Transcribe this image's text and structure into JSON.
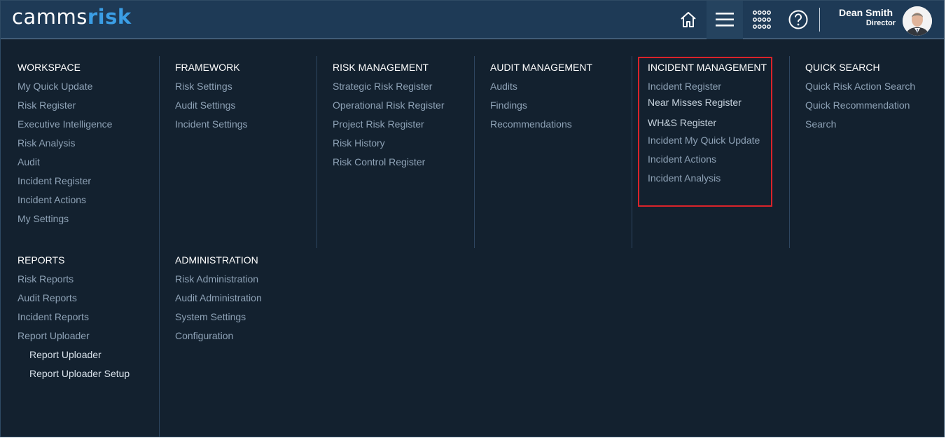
{
  "app": {
    "logo_part1": "camms",
    "logo_part2": "risk"
  },
  "header": {
    "icons": [
      "home-icon",
      "menu-icon",
      "apps-grid-icon",
      "help-icon"
    ],
    "user": {
      "name": "Dean Smith",
      "role": "Director"
    }
  },
  "colors": {
    "background": "#13212f",
    "topbar": "#1e3a56",
    "accent": "#3b9ee5",
    "menu_text": "#8ea2b6",
    "highlight_border": "#d9232a"
  },
  "sections": {
    "workspace": {
      "title": "WORKSPACE",
      "items": [
        "My Quick Update",
        "Risk Register",
        "Executive Intelligence",
        "Risk Analysis",
        "Audit",
        "Incident Register",
        "Incident Actions",
        "My Settings"
      ]
    },
    "framework": {
      "title": "FRAMEWORK",
      "items": [
        "Risk Settings",
        "Audit Settings",
        "Incident Settings"
      ]
    },
    "risk_management": {
      "title": "RISK MANAGEMENT",
      "items": [
        "Strategic Risk Register",
        "Operational Risk Register",
        "Project Risk Register",
        "Risk History",
        "Risk Control Register"
      ]
    },
    "audit_management": {
      "title": "AUDIT MANAGEMENT",
      "items": [
        "Audits",
        "Findings",
        "Recommendations"
      ]
    },
    "incident_management": {
      "title": "INCIDENT MANAGEMENT",
      "items": [
        "Incident Register",
        "Near Misses Register",
        "WH&S Register",
        "Incident My Quick Update",
        "Incident Actions",
        "Incident Analysis"
      ]
    },
    "quick_search": {
      "title": "QUICK SEARCH",
      "items": [
        "Quick Risk Action Search",
        "Quick Recommendation",
        "Search"
      ]
    },
    "reports": {
      "title": "REPORTS",
      "items": [
        "Risk Reports",
        "Audit Reports",
        "Incident Reports",
        "Report Uploader"
      ],
      "sub_items": [
        "Report Uploader",
        "Report Uploader Setup"
      ]
    },
    "administration": {
      "title": "ADMINISTRATION",
      "items": [
        "Risk Administration",
        "Audit Administration",
        "System Settings",
        "Configuration"
      ]
    }
  }
}
